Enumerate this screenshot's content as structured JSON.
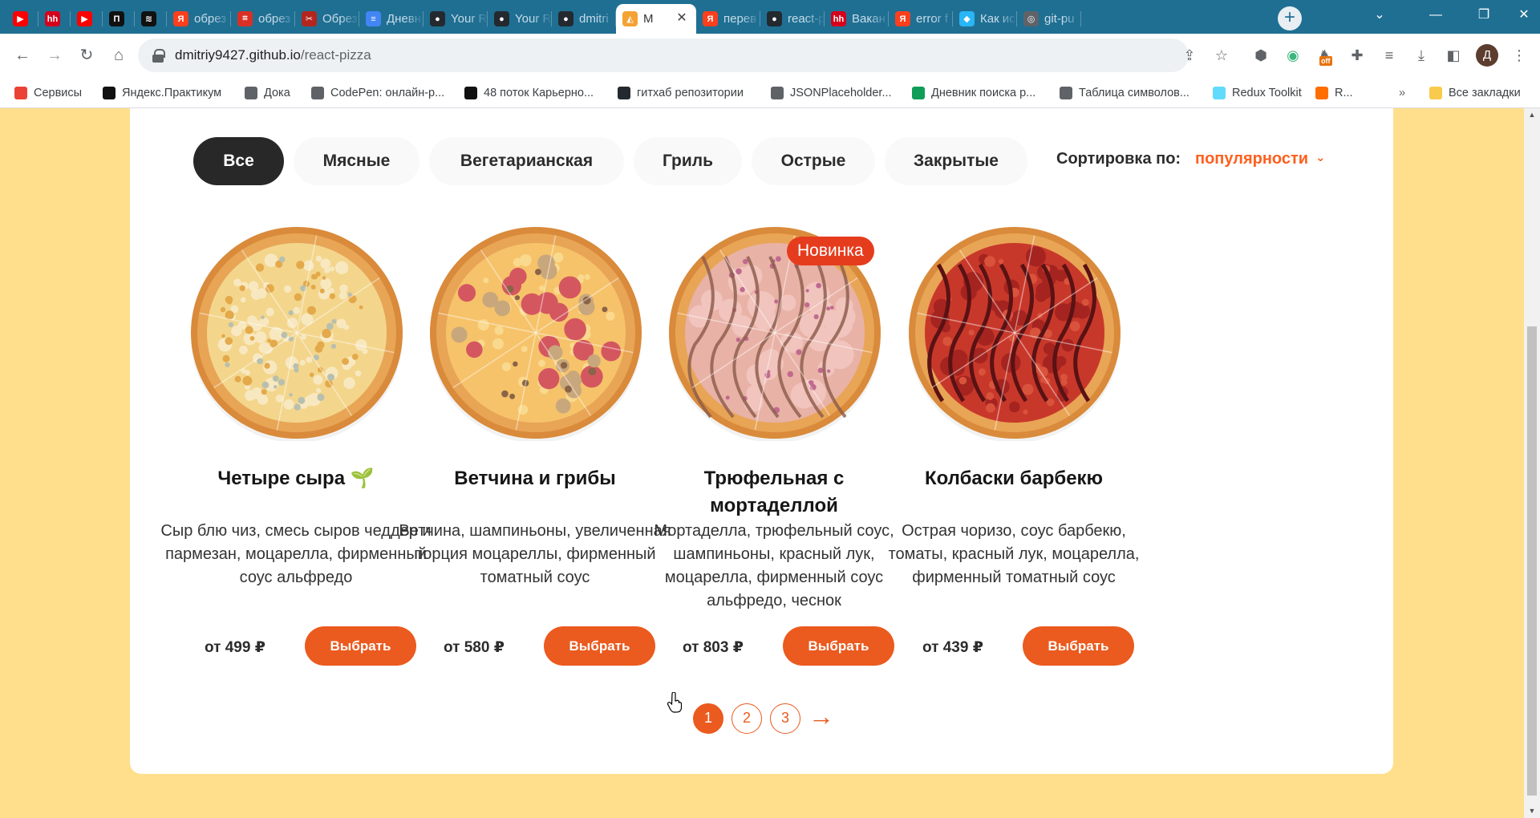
{
  "browser": {
    "tabs": [
      {
        "title": "",
        "icon": "youtube-icon",
        "color": "#ff0000",
        "glyph": "▶"
      },
      {
        "title": "",
        "icon": "hh-icon",
        "color": "#d6001c",
        "glyph": "hh"
      },
      {
        "title": "",
        "icon": "youtube-icon",
        "color": "#ff0000",
        "glyph": "▶"
      },
      {
        "title": "",
        "icon": "practicum-icon",
        "color": "#111111",
        "glyph": "П"
      },
      {
        "title": "",
        "icon": "stack-icon",
        "color": "#111111",
        "glyph": "≋"
      },
      {
        "title": "обрез",
        "icon": "yandex-icon",
        "color": "#fc3f1d",
        "glyph": "Я"
      },
      {
        "title": "обрез",
        "icon": "crop-icon",
        "color": "#d93025",
        "glyph": "⌗"
      },
      {
        "title": "Обрез",
        "icon": "scissors-icon",
        "color": "#b3261e",
        "glyph": "✂"
      },
      {
        "title": "Дневн",
        "icon": "docs-icon",
        "color": "#4285f4",
        "glyph": "≡"
      },
      {
        "title": "Your R",
        "icon": "github-icon",
        "color": "#24292f",
        "glyph": "●"
      },
      {
        "title": "Your R",
        "icon": "github-icon",
        "color": "#24292f",
        "glyph": "●"
      },
      {
        "title": "dmitri",
        "icon": "github-icon",
        "color": "#24292f",
        "glyph": "●"
      },
      {
        "title": "M",
        "icon": "pizza-icon",
        "color": "#f4a234",
        "glyph": "◭",
        "active": true
      },
      {
        "title": "перев",
        "icon": "yandex-icon",
        "color": "#fc3f1d",
        "glyph": "Я"
      },
      {
        "title": "react-p",
        "icon": "github-icon",
        "color": "#24292f",
        "glyph": "●"
      },
      {
        "title": "Вакан",
        "icon": "hh-icon",
        "color": "#d6001c",
        "glyph": "hh"
      },
      {
        "title": "error f",
        "icon": "yandex-icon",
        "color": "#fc3f1d",
        "glyph": "Я"
      },
      {
        "title": "Как ис",
        "icon": "flutter-icon",
        "color": "#29b6f6",
        "glyph": "◆"
      },
      {
        "title": "git-pu",
        "icon": "globe-icon",
        "color": "#5f6368",
        "glyph": "◎"
      }
    ],
    "url_host": "dmitriy9427.github.io",
    "url_path": "/react-pizza",
    "profile_initial": "Д",
    "ext_badge": "off",
    "bookmarks": [
      {
        "label": "Сервисы",
        "icon": "apps-grid-icon",
        "color": "#ea4335"
      },
      {
        "label": "Яндекс.Практикум",
        "icon": "practicum-icon",
        "color": "#111111"
      },
      {
        "label": "Дока",
        "icon": "globe-icon",
        "color": "#5f6368"
      },
      {
        "label": "CodePen: онлайн-р...",
        "icon": "globe-icon",
        "color": "#5f6368"
      },
      {
        "label": "48 поток Карьерно...",
        "icon": "stack-icon",
        "color": "#111111"
      },
      {
        "label": "гитхаб репозитории",
        "icon": "github-icon",
        "color": "#24292f"
      },
      {
        "label": "JSONPlaceholder...",
        "icon": "code-icon",
        "color": "#5f6368"
      },
      {
        "label": "Дневник поиска р...",
        "icon": "drive-icon",
        "color": "#0f9d58"
      },
      {
        "label": "Таблица символов...",
        "icon": "globe-icon",
        "color": "#5f6368"
      },
      {
        "label": "Redux Toolkit",
        "icon": "redux-icon",
        "color": "#61dafb"
      },
      {
        "label": "R...",
        "icon": "bolt-icon",
        "color": "#ff6d00"
      }
    ],
    "bookmarks_more": "»",
    "all_bookmarks": "Все закладки"
  },
  "page": {
    "categories": [
      "Все",
      "Мясные",
      "Вегетарианская",
      "Гриль",
      "Острые",
      "Закрытые"
    ],
    "active_category": 0,
    "sort_label": "Сортировка по:",
    "sort_value": "популярности",
    "pizzas": [
      {
        "name": "Четыре сыра",
        "veg": true,
        "description": "Сыр блю чиз, смесь сыров чеддер и пармезан, моцарелла, фирменный соус альфредо",
        "price": "от 499 ₽",
        "button": "Выбрать",
        "badge": "",
        "kind": "cheese"
      },
      {
        "name": "Ветчина и грибы",
        "veg": false,
        "description": "Ветчина, шампиньоны, увеличенная порция моцареллы, фирменный томатный соус",
        "price": "от 580 ₽",
        "button": "Выбрать",
        "badge": "",
        "kind": "mushroom"
      },
      {
        "name": "Трюфельная с мортаделлой",
        "veg": false,
        "description": "Мортаделла, трюфельный соус, шампиньоны, красный лук, моцарелла, фирменный соус альфредо, чеснок",
        "price": "от 803 ₽",
        "button": "Выбрать",
        "badge": "Новинка",
        "kind": "mortadella"
      },
      {
        "name": "Колбаски барбекю",
        "veg": false,
        "description": "Острая чоризо, соус барбекю, томаты, красный лук, моцарелла, фирменный томатный соус",
        "price": "от 439 ₽",
        "button": "Выбрать",
        "badge": "",
        "kind": "bbq"
      }
    ],
    "pagination": [
      "1",
      "2",
      "3"
    ],
    "active_page": 0,
    "accent_color": "#fe5f1e",
    "background_color": "#ffdf8c"
  }
}
